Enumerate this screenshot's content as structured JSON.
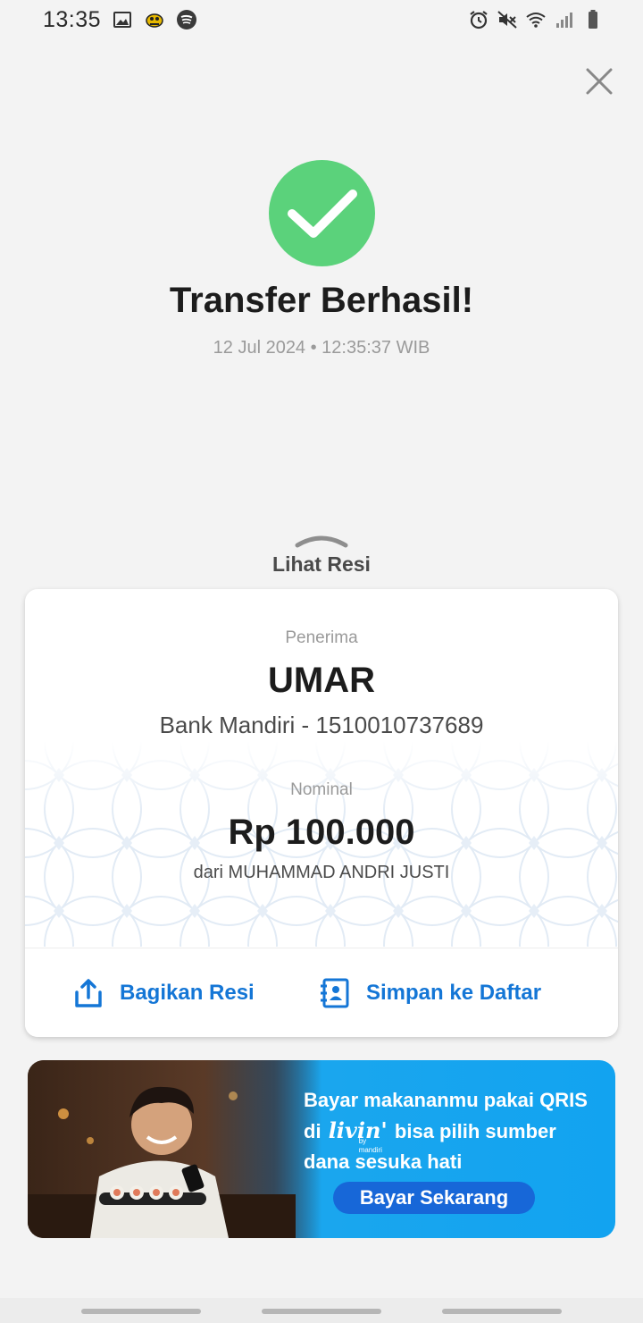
{
  "status_bar": {
    "time": "13:35",
    "left_icons": [
      "image-icon",
      "app-notification-icon",
      "spotify-icon"
    ],
    "right_icons": [
      "alarm-icon",
      "mute-icon",
      "wifi-icon",
      "signal-icon",
      "battery-icon"
    ]
  },
  "header": {
    "close_icon": "close-icon"
  },
  "result": {
    "title": "Transfer Berhasil!",
    "datetime": "12 Jul 2024 • 12:35:37 WIB",
    "success_color": "#5bd27b"
  },
  "receipt_toggle": {
    "label": "Lihat Resi"
  },
  "receipt": {
    "recipient_label": "Penerima",
    "recipient_name": "UMAR",
    "recipient_bank": "Bank Mandiri - 1510010737689",
    "amount_label": "Nominal",
    "amount": "Rp 100.000",
    "sender": "dari MUHAMMAD ANDRI JUSTI",
    "actions": {
      "share_label": "Bagikan Resi",
      "save_label": "Simpan ke Daftar"
    },
    "accent_color": "#1476d6"
  },
  "banner": {
    "line1": "Bayar makananmu pakai QRIS",
    "line2_prefix": "di",
    "logo_text": "livin'",
    "logo_sub": "by mandiri",
    "line2_suffix": "bisa pilih sumber",
    "line3": "dana sesuka hati",
    "cta": "Bayar Sekarang"
  }
}
